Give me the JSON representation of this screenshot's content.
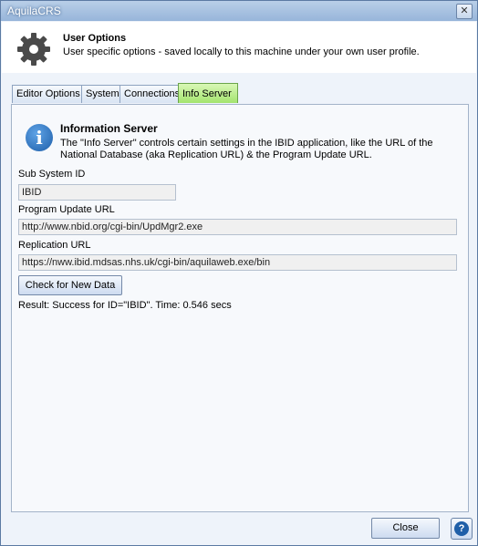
{
  "window": {
    "title": "AquilaCRS",
    "close_glyph": "✕"
  },
  "header": {
    "title": "User Options",
    "subtitle": "User specific options - saved locally to this machine under your own user profile.",
    "icon": "gear-icon"
  },
  "tabs": [
    {
      "label": "Editor Options",
      "active": false
    },
    {
      "label": "System",
      "active": false
    },
    {
      "label": "Connections",
      "active": false
    },
    {
      "label": "Info Server",
      "active": true
    }
  ],
  "panel": {
    "info_icon": "info-icon",
    "info_glyph": "i",
    "info_title": "Information Server",
    "info_description": "The \"Info Server\" controls certain settings in the IBID application, like the URL of the National Database (aka Replication URL) & the Program Update URL.",
    "subsystem": {
      "label": "Sub System ID",
      "value": "IBID"
    },
    "update_url": {
      "label": "Program Update URL",
      "value": "http://www.nbid.org/cgi-bin/UpdMgr2.exe"
    },
    "replication_url": {
      "label": "Replication URL",
      "value": "https://nww.ibid.mdsas.nhs.uk/cgi-bin/aquilaweb.exe/bin"
    },
    "check_button": "Check for New Data",
    "result": "Result: Success for ID=\"IBID\". Time: 0.546 secs"
  },
  "footer": {
    "close_label": "Close",
    "help_glyph": "?"
  }
}
